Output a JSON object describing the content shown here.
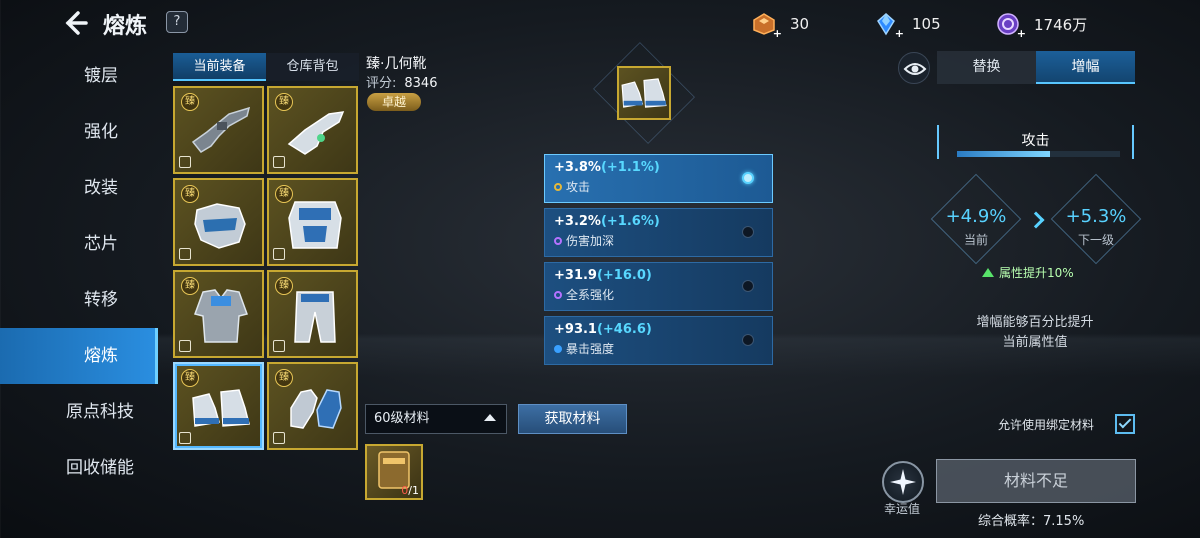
{
  "header": {
    "title": "熔炼",
    "help": "?",
    "currencies": [
      {
        "icon": "material-box-icon",
        "value": "30"
      },
      {
        "icon": "blue-crystal-icon",
        "value": "105"
      },
      {
        "icon": "purple-coin-icon",
        "value": "1746万"
      }
    ]
  },
  "nav": {
    "items": [
      {
        "label": "镀层"
      },
      {
        "label": "强化"
      },
      {
        "label": "改装"
      },
      {
        "label": "芯片"
      },
      {
        "label": "转移"
      },
      {
        "label": "熔炼",
        "active": true
      },
      {
        "label": "原点科技"
      },
      {
        "label": "回收储能"
      }
    ]
  },
  "equip_tabs": [
    "当前装备",
    "仓库背包"
  ],
  "equipment": [
    {
      "name": "rifle",
      "badge": "臻"
    },
    {
      "name": "pistol",
      "badge": "臻"
    },
    {
      "name": "helmet",
      "badge": "臻"
    },
    {
      "name": "chest-armor",
      "badge": "臻"
    },
    {
      "name": "jacket",
      "badge": "臻"
    },
    {
      "name": "pants",
      "badge": "臻"
    },
    {
      "name": "boots",
      "badge": "臻",
      "selected": true
    },
    {
      "name": "gloves",
      "badge": "臻"
    }
  ],
  "item": {
    "name": "臻·几何靴",
    "score_label": "评分:",
    "score": "8346",
    "grade": "卓越"
  },
  "stats": [
    {
      "value": "+3.8%",
      "inc": "(+1.1%)",
      "name": "攻击",
      "dot": "gold",
      "selected": true
    },
    {
      "value": "+3.2%",
      "inc": "(+1.6%)",
      "name": "伤害加深",
      "dot": "purple",
      "selected": false
    },
    {
      "value": "+31.9",
      "inc": "(+16.0)",
      "name": "全系强化",
      "dot": "purple",
      "selected": false
    },
    {
      "value": "+93.1",
      "inc": "(+46.6)",
      "name": "暴击强度",
      "dot": "blue",
      "selected": false
    }
  ],
  "materials": {
    "select_value": "60级材料",
    "get_button": "获取材料",
    "item_label": "熔炼材料",
    "have": "0",
    "need": "/1"
  },
  "right": {
    "tabs": [
      "替换",
      "增幅"
    ],
    "active_tab": "增幅",
    "panel_title": "攻击",
    "progress": 0.57,
    "current_value": "+4.9%",
    "current_label": "当前",
    "next_value": "+5.3%",
    "next_label": "下一级",
    "boost_text": "属性提升10%",
    "desc_line1": "增幅能够百分比提升",
    "desc_line2": "当前属性值",
    "allow_bound": "允许使用绑定材料",
    "allow_checked": true,
    "luck_label": "幸运值",
    "action_button": "材料不足",
    "rate_text": "综合概率：7.15%"
  },
  "colors": {
    "accent": "#58d2ff",
    "gold_frame": "#c7a831",
    "active_nav": "#2a8ee0"
  }
}
